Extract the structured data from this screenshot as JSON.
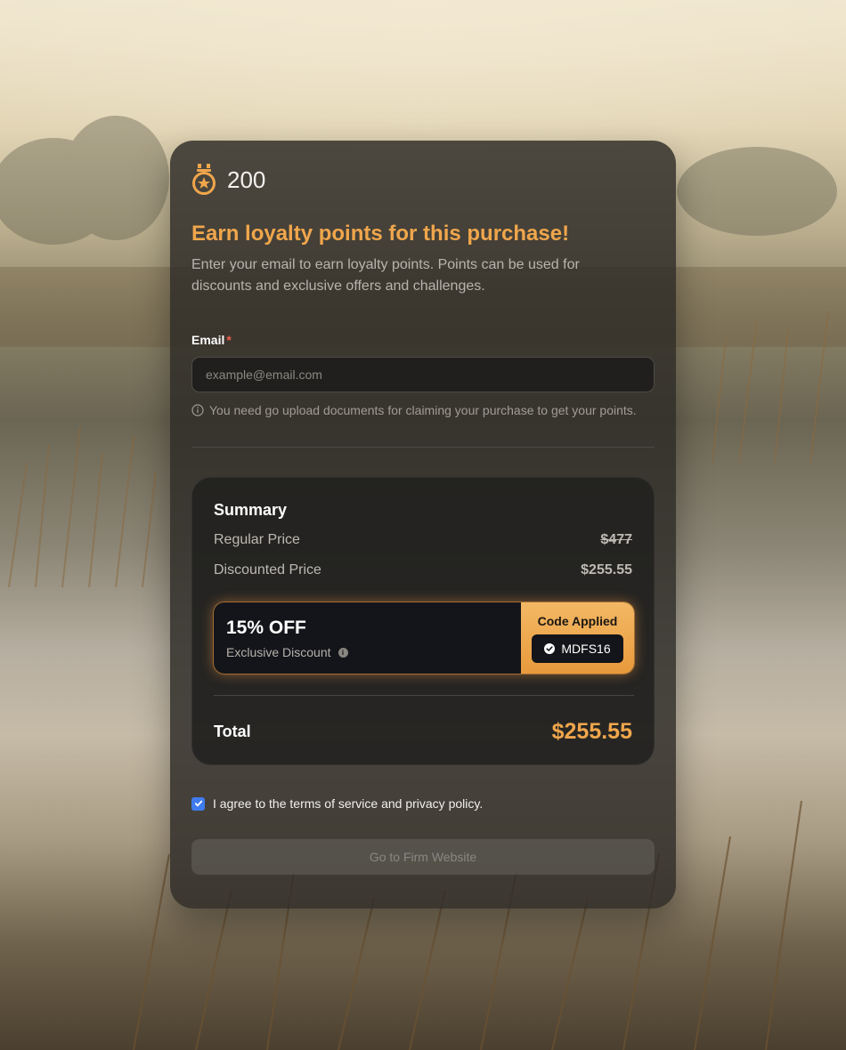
{
  "loyalty": {
    "points": "200",
    "icon": "medal-star-icon"
  },
  "heading": "Earn loyalty points for this purchase!",
  "description": "Enter your email to earn loyalty points. Points can be used for discounts and exclusive offers and challenges.",
  "email": {
    "label": "Email",
    "required_mark": "*",
    "placeholder": "example@email.com",
    "value": "",
    "hint": "You need go upload documents for claiming your purchase to get your points."
  },
  "summary": {
    "title": "Summary",
    "regular_price_label": "Regular Price",
    "regular_price_value": "$477",
    "discounted_price_label": "Discounted Price",
    "discounted_price_value": "$255.55",
    "discount": {
      "percent": "15% OFF",
      "subtitle": "Exclusive Discount",
      "code_applied_label": "Code Applied",
      "code": "MDFS16"
    },
    "total_label": "Total",
    "total_value": "$255.55"
  },
  "agreement": {
    "checked": true,
    "text": "I agree to the terms of service and privacy policy."
  },
  "cta": {
    "label": "Go to Firm Website",
    "disabled": true
  },
  "colors": {
    "accent": "#f0a64c",
    "checkbox": "#3f7bef",
    "error": "#f25a4a"
  }
}
